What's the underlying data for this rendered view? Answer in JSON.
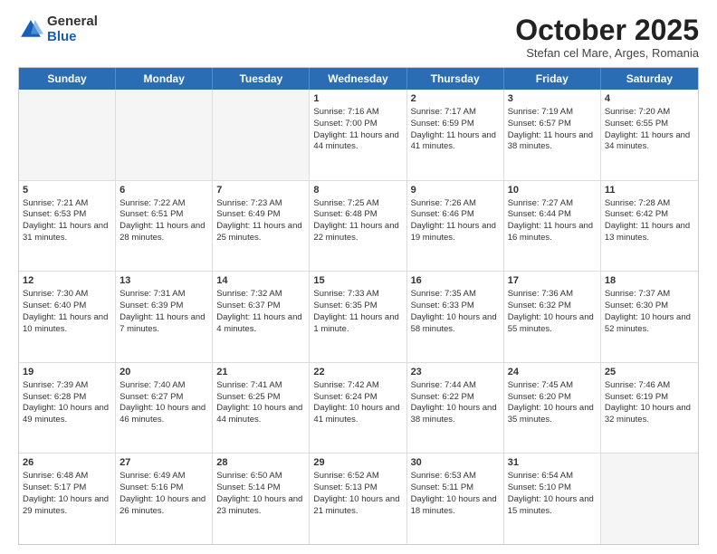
{
  "logo": {
    "general": "General",
    "blue": "Blue"
  },
  "header": {
    "month": "October 2025",
    "location": "Stefan cel Mare, Arges, Romania"
  },
  "weekdays": [
    "Sunday",
    "Monday",
    "Tuesday",
    "Wednesday",
    "Thursday",
    "Friday",
    "Saturday"
  ],
  "rows": [
    [
      {
        "day": "",
        "info": "",
        "empty": true
      },
      {
        "day": "",
        "info": "",
        "empty": true
      },
      {
        "day": "",
        "info": "",
        "empty": true
      },
      {
        "day": "1",
        "info": "Sunrise: 7:16 AM\nSunset: 7:00 PM\nDaylight: 11 hours and 44 minutes."
      },
      {
        "day": "2",
        "info": "Sunrise: 7:17 AM\nSunset: 6:59 PM\nDaylight: 11 hours and 41 minutes."
      },
      {
        "day": "3",
        "info": "Sunrise: 7:19 AM\nSunset: 6:57 PM\nDaylight: 11 hours and 38 minutes."
      },
      {
        "day": "4",
        "info": "Sunrise: 7:20 AM\nSunset: 6:55 PM\nDaylight: 11 hours and 34 minutes."
      }
    ],
    [
      {
        "day": "5",
        "info": "Sunrise: 7:21 AM\nSunset: 6:53 PM\nDaylight: 11 hours and 31 minutes."
      },
      {
        "day": "6",
        "info": "Sunrise: 7:22 AM\nSunset: 6:51 PM\nDaylight: 11 hours and 28 minutes."
      },
      {
        "day": "7",
        "info": "Sunrise: 7:23 AM\nSunset: 6:49 PM\nDaylight: 11 hours and 25 minutes."
      },
      {
        "day": "8",
        "info": "Sunrise: 7:25 AM\nSunset: 6:48 PM\nDaylight: 11 hours and 22 minutes."
      },
      {
        "day": "9",
        "info": "Sunrise: 7:26 AM\nSunset: 6:46 PM\nDaylight: 11 hours and 19 minutes."
      },
      {
        "day": "10",
        "info": "Sunrise: 7:27 AM\nSunset: 6:44 PM\nDaylight: 11 hours and 16 minutes."
      },
      {
        "day": "11",
        "info": "Sunrise: 7:28 AM\nSunset: 6:42 PM\nDaylight: 11 hours and 13 minutes."
      }
    ],
    [
      {
        "day": "12",
        "info": "Sunrise: 7:30 AM\nSunset: 6:40 PM\nDaylight: 11 hours and 10 minutes."
      },
      {
        "day": "13",
        "info": "Sunrise: 7:31 AM\nSunset: 6:39 PM\nDaylight: 11 hours and 7 minutes."
      },
      {
        "day": "14",
        "info": "Sunrise: 7:32 AM\nSunset: 6:37 PM\nDaylight: 11 hours and 4 minutes."
      },
      {
        "day": "15",
        "info": "Sunrise: 7:33 AM\nSunset: 6:35 PM\nDaylight: 11 hours and 1 minute."
      },
      {
        "day": "16",
        "info": "Sunrise: 7:35 AM\nSunset: 6:33 PM\nDaylight: 10 hours and 58 minutes."
      },
      {
        "day": "17",
        "info": "Sunrise: 7:36 AM\nSunset: 6:32 PM\nDaylight: 10 hours and 55 minutes."
      },
      {
        "day": "18",
        "info": "Sunrise: 7:37 AM\nSunset: 6:30 PM\nDaylight: 10 hours and 52 minutes."
      }
    ],
    [
      {
        "day": "19",
        "info": "Sunrise: 7:39 AM\nSunset: 6:28 PM\nDaylight: 10 hours and 49 minutes."
      },
      {
        "day": "20",
        "info": "Sunrise: 7:40 AM\nSunset: 6:27 PM\nDaylight: 10 hours and 46 minutes."
      },
      {
        "day": "21",
        "info": "Sunrise: 7:41 AM\nSunset: 6:25 PM\nDaylight: 10 hours and 44 minutes."
      },
      {
        "day": "22",
        "info": "Sunrise: 7:42 AM\nSunset: 6:24 PM\nDaylight: 10 hours and 41 minutes."
      },
      {
        "day": "23",
        "info": "Sunrise: 7:44 AM\nSunset: 6:22 PM\nDaylight: 10 hours and 38 minutes."
      },
      {
        "day": "24",
        "info": "Sunrise: 7:45 AM\nSunset: 6:20 PM\nDaylight: 10 hours and 35 minutes."
      },
      {
        "day": "25",
        "info": "Sunrise: 7:46 AM\nSunset: 6:19 PM\nDaylight: 10 hours and 32 minutes."
      }
    ],
    [
      {
        "day": "26",
        "info": "Sunrise: 6:48 AM\nSunset: 5:17 PM\nDaylight: 10 hours and 29 minutes."
      },
      {
        "day": "27",
        "info": "Sunrise: 6:49 AM\nSunset: 5:16 PM\nDaylight: 10 hours and 26 minutes."
      },
      {
        "day": "28",
        "info": "Sunrise: 6:50 AM\nSunset: 5:14 PM\nDaylight: 10 hours and 23 minutes."
      },
      {
        "day": "29",
        "info": "Sunrise: 6:52 AM\nSunset: 5:13 PM\nDaylight: 10 hours and 21 minutes."
      },
      {
        "day": "30",
        "info": "Sunrise: 6:53 AM\nSunset: 5:11 PM\nDaylight: 10 hours and 18 minutes."
      },
      {
        "day": "31",
        "info": "Sunrise: 6:54 AM\nSunset: 5:10 PM\nDaylight: 10 hours and 15 minutes."
      },
      {
        "day": "",
        "info": "",
        "empty": true
      }
    ]
  ]
}
